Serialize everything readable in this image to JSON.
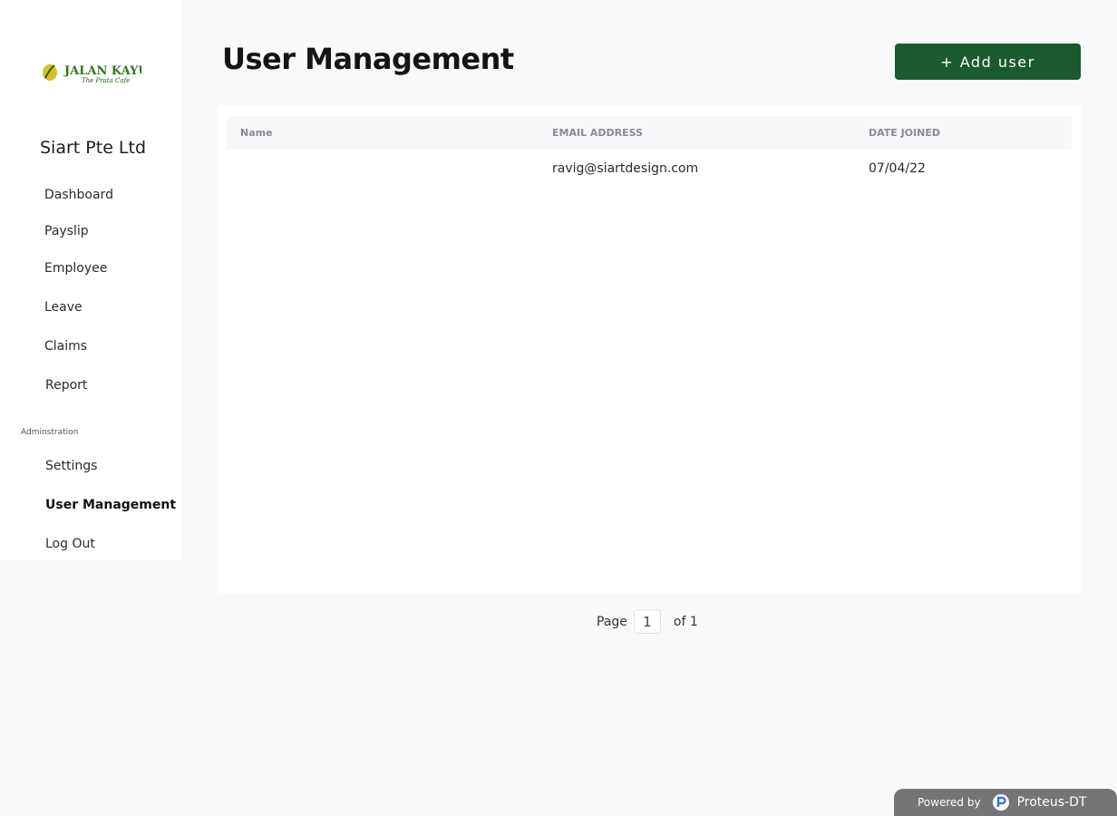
{
  "sidebar": {
    "logo": {
      "name": "JalanKayu",
      "tagline": "The Prata Cafe",
      "colors": {
        "text": "#2f7a1a",
        "leaf": "#d8c21e",
        "accent": "#1f5a12"
      }
    },
    "company": "Siart Pte Ltd",
    "items": [
      {
        "label": "Dashboard"
      },
      {
        "label": "Payslip"
      },
      {
        "label": "Employee"
      },
      {
        "label": "Leave"
      },
      {
        "label": "Claims"
      },
      {
        "label": "Report"
      }
    ],
    "admin_section_label": "Adminstration",
    "admin_items": [
      {
        "label": "Settings"
      },
      {
        "label": "User Management",
        "active": true
      },
      {
        "label": "Log Out"
      }
    ]
  },
  "header": {
    "title": "User Management",
    "add_button_label": "+ Add user",
    "add_button_color": "#1b5a2e"
  },
  "table": {
    "columns": [
      "Name",
      "EMAIL ADDRESS",
      "DATE JOINED"
    ],
    "rows": [
      {
        "name": "",
        "email": "ravig@siartdesign.com",
        "date_joined": "07/04/22"
      }
    ]
  },
  "pagination": {
    "page_label": "Page",
    "current_page": "1",
    "total_label": "of 1"
  },
  "footer": {
    "powered_by_label": "Powered by",
    "brand": "Proteus-DT",
    "brand_icon": "proteus-logo-icon"
  }
}
